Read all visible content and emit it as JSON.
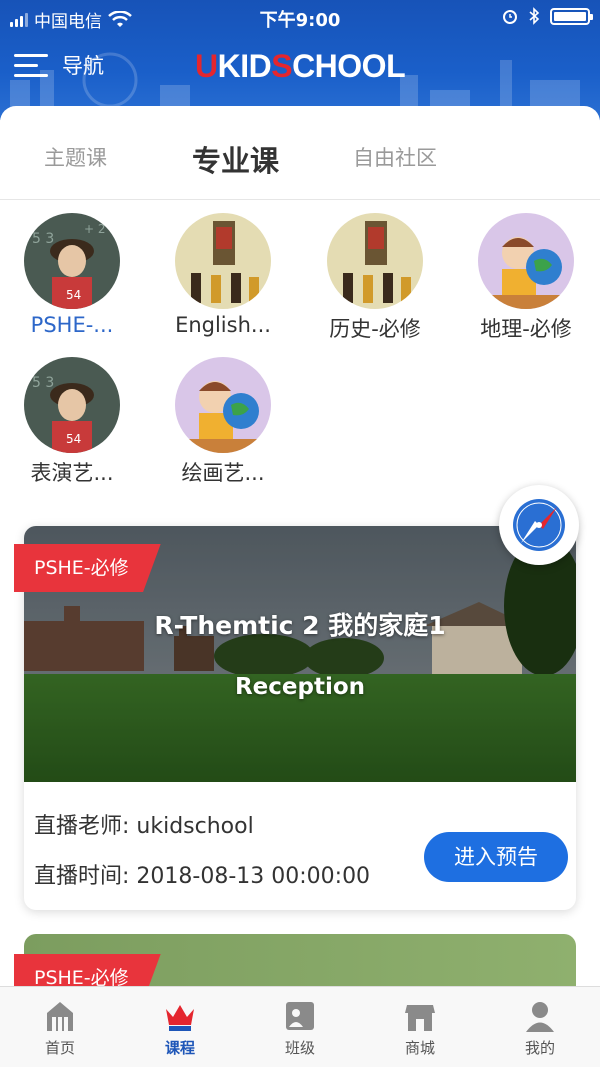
{
  "status_bar": {
    "carrier": "中国电信",
    "time": "下午9:00"
  },
  "header": {
    "nav_label": "导航",
    "logo": {
      "part1": "U",
      "part2": "KID",
      "part3": "S",
      "part4": "CHOOL"
    },
    "colors": {
      "brand_blue": "#1a5fc9",
      "brand_red": "#e4262e"
    }
  },
  "tabs": [
    {
      "label": "主题课",
      "active": false
    },
    {
      "label": "专业课",
      "active": true
    },
    {
      "label": "自由社区",
      "active": false
    }
  ],
  "courses": [
    {
      "label": "PSHE-...",
      "icon": "boy-portrait-icon",
      "active": true
    },
    {
      "label": "English...",
      "icon": "book-cover-icon",
      "active": false
    },
    {
      "label": "历史-必修",
      "icon": "book-cover-icon",
      "active": false
    },
    {
      "label": "地理-必修",
      "icon": "boy-globe-icon",
      "active": false
    },
    {
      "label": "表演艺...",
      "icon": "boy-portrait-icon",
      "active": false
    },
    {
      "label": "绘画艺...",
      "icon": "boy-globe-icon",
      "active": false
    }
  ],
  "live_card": {
    "tag": "PSHE-必修",
    "title": "R-Themtic 2 我的家庭1",
    "subtitle": "Reception",
    "teacher": "直播老师: ukidschool",
    "time": "直播时间: 2018-08-13 00:00:00",
    "button": "进入预告"
  },
  "next_card": {
    "tag": "PSHE-必修"
  },
  "bottom_nav": [
    {
      "label": "首页",
      "icon": "home-icon",
      "active": false
    },
    {
      "label": "课程",
      "icon": "crown-icon",
      "active": true
    },
    {
      "label": "班级",
      "icon": "class-icon",
      "active": false
    },
    {
      "label": "商城",
      "icon": "shop-icon",
      "active": false
    },
    {
      "label": "我的",
      "icon": "profile-icon",
      "active": false
    }
  ]
}
